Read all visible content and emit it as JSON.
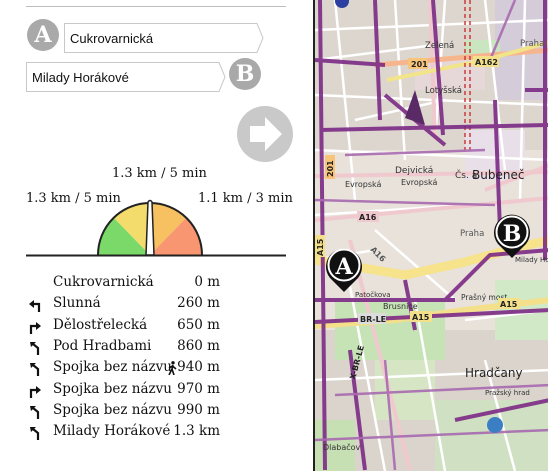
{
  "start": {
    "marker": "A",
    "value": "Cukrovarnická"
  },
  "end": {
    "marker": "B",
    "value": "Milady Horákové"
  },
  "gauge": {
    "top_label": "1.3 km / 5 min",
    "left_label": "1.3 km / 5 min",
    "right_label": "1.1 km / 3 min"
  },
  "route": [
    {
      "icon": "none",
      "name": "Cukrovarnická",
      "dist": "0 m"
    },
    {
      "icon": "turn-left-icon",
      "name": "Slunná",
      "dist": "260 m"
    },
    {
      "icon": "turn-right-icon",
      "name": "Dělostřelecká",
      "dist": "650 m"
    },
    {
      "icon": "bear-left-icon",
      "name": "Pod Hradbami",
      "dist": "860 m"
    },
    {
      "icon": "bear-left-icon",
      "name": "Spojka bez názvu",
      "dist": "940 m",
      "walk": true
    },
    {
      "icon": "turn-right-icon",
      "name": "Spojka bez názvu",
      "dist": "970 m"
    },
    {
      "icon": "bear-left-icon",
      "name": "Spojka bez názvu",
      "dist": "990 m"
    },
    {
      "icon": "bear-left-icon",
      "name": "Milady Horákové",
      "dist": "1.3 km"
    }
  ],
  "map": {
    "labels": [
      "Zelená",
      "Lotyšská",
      "Dejvická",
      "Evropská",
      "Evropská",
      "Čs. a",
      "Bubeneč",
      "Praha",
      "Praha",
      "Brusnice",
      "Prašný most",
      "Hradčany",
      "Pražský hrad",
      "Patočkova",
      "Milady Hor.",
      "Dlabačov"
    ],
    "road_refs": [
      "201",
      "A162",
      "201",
      "A16",
      "A15",
      "A15",
      "BR-LE",
      "A15",
      "X-BR-LE",
      "A16"
    ],
    "markers": [
      "A",
      "B"
    ]
  }
}
